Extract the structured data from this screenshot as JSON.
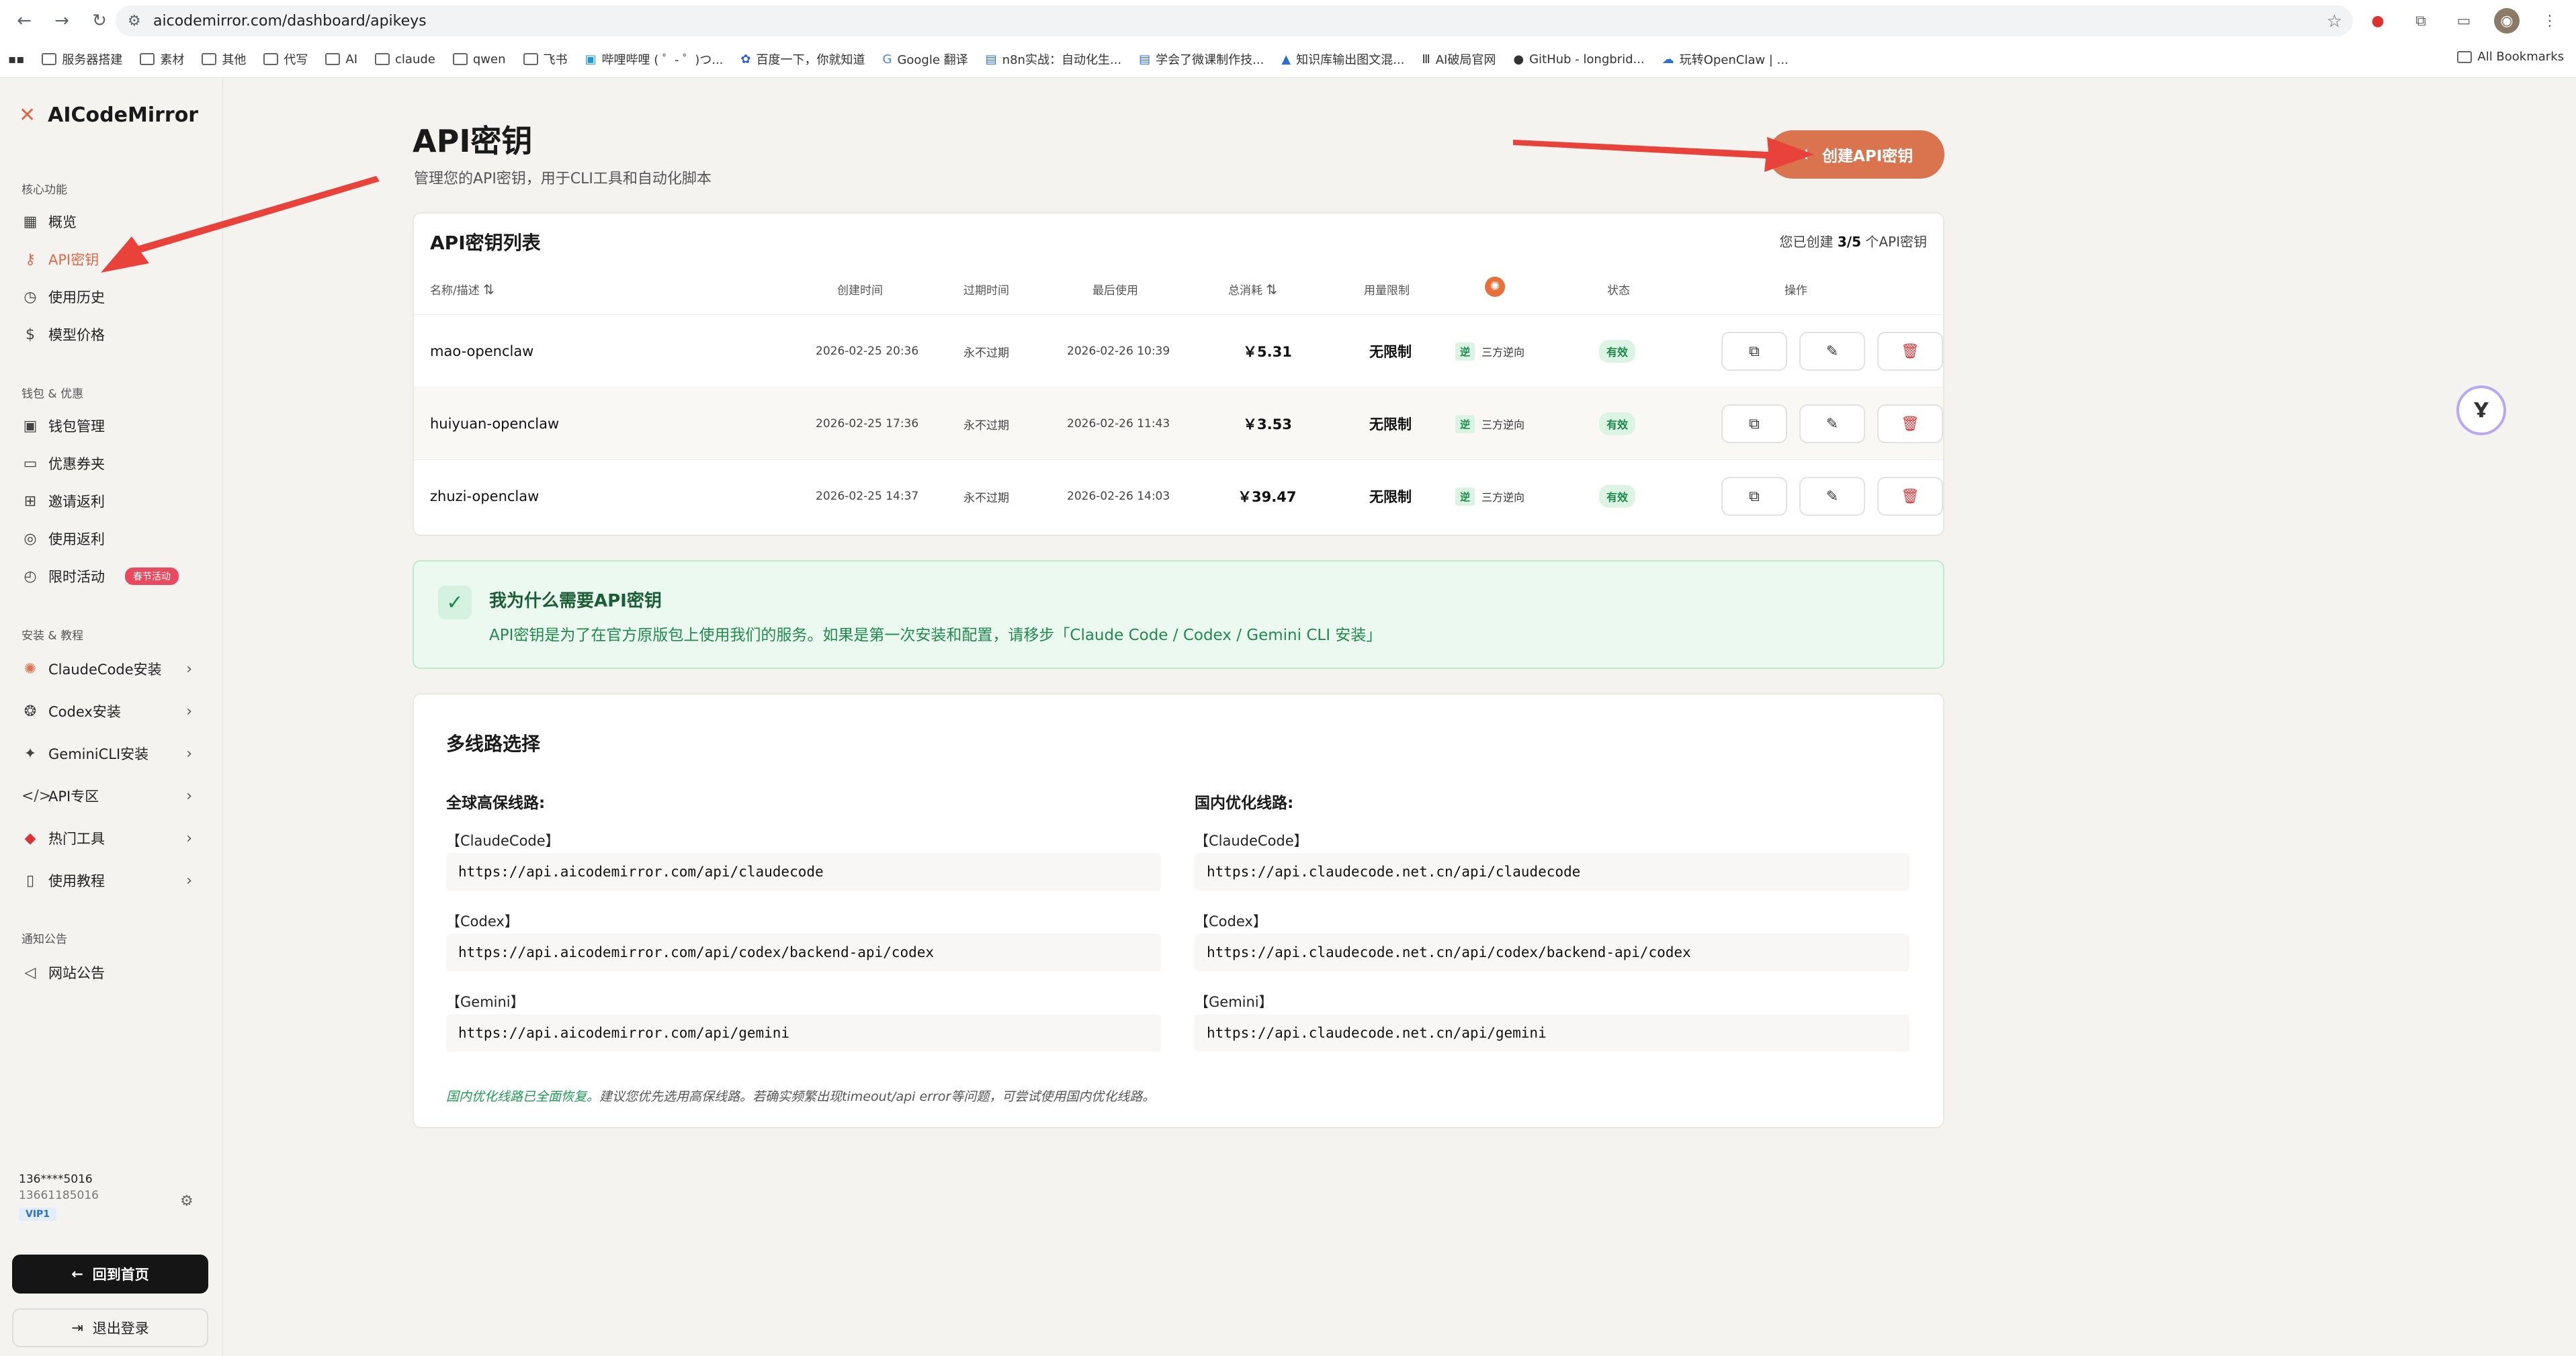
{
  "browser": {
    "url": "aicodemirror.com/dashboard/apikeys",
    "bookmarks": [
      "服务器搭建",
      "素材",
      "其他",
      "代写",
      "AI",
      "claude",
      "qwen",
      "飞书",
      "哔哩哔哩 ( ゜- ゜)つ...",
      "百度一下，你就知道",
      "Google 翻译",
      "n8n实战：自动化生...",
      "学会了微课制作技...",
      "知识库输出图文混...",
      "AI破局官网",
      "GitHub - longbrid...",
      "玩转OpenClaw | ..."
    ],
    "all_bookmarks": "All Bookmarks"
  },
  "sidebar": {
    "brand": "AICodeMirror",
    "sections": {
      "core": "核心功能",
      "wallet": "钱包 & 优惠",
      "install": "安装 & 教程",
      "notice": "通知公告"
    },
    "core_items": [
      "概览",
      "API密钥",
      "使用历史",
      "模型价格"
    ],
    "wallet_items": [
      "钱包管理",
      "优惠券夹",
      "邀请返利",
      "使用返利",
      "限时活动"
    ],
    "hot_badge": "春节活动",
    "install_items": [
      "ClaudeCode安装",
      "Codex安装",
      "GeminiCLI安装",
      "API专区",
      "热门工具",
      "使用教程"
    ],
    "notice_items": [
      "网站公告"
    ],
    "user": {
      "masked": "136****5016",
      "phone": "13661185016",
      "vip": "VIP1"
    },
    "home_button": "回到首页",
    "logout_button": "退出登录"
  },
  "page": {
    "title": "API密钥",
    "subtitle": "管理您的API密钥，用于CLI工具和自动化脚本",
    "create_button": "创建API密钥"
  },
  "table": {
    "title": "API密钥列表",
    "count_prefix": "您已创建",
    "count_value": "3/5",
    "count_suffix": "个API密钥",
    "headers": {
      "name": "名称/描述",
      "created": "创建时间",
      "expires": "过期时间",
      "last_used": "最后使用",
      "total": "总消耗",
      "limit": "用量限制",
      "status": "状态",
      "actions": "操作"
    },
    "rows": [
      {
        "name": "mao-openclaw",
        "created": "2026-02-25 20:36",
        "expires": "永不过期",
        "last_used": "2026-02-26 10:39",
        "total": "￥5.31",
        "limit": "无限制",
        "tag_icon": "逆",
        "tag_text": "三方逆向",
        "status": "有效"
      },
      {
        "name": "huiyuan-openclaw",
        "created": "2026-02-25 17:36",
        "expires": "永不过期",
        "last_used": "2026-02-26 11:43",
        "total": "￥3.53",
        "limit": "无限制",
        "tag_icon": "逆",
        "tag_text": "三方逆向",
        "status": "有效"
      },
      {
        "name": "zhuzi-openclaw",
        "created": "2026-02-25 14:37",
        "expires": "永不过期",
        "last_used": "2026-02-26 14:03",
        "total": "￥39.47",
        "limit": "无限制",
        "tag_icon": "逆",
        "tag_text": "三方逆向",
        "status": "有效"
      }
    ]
  },
  "info": {
    "title": "我为什么需要API密钥",
    "text": "API密钥是为了在官方原版包上使用我们的服务。如果是第一次安装和配置，请移步「Claude Code / Codex / Gemini CLI 安装」"
  },
  "routes": {
    "title": "多线路选择",
    "global_heading": "全球高保线路:",
    "domestic_heading": "国内优化线路:",
    "labels": [
      "【ClaudeCode】",
      "【Codex】",
      "【Gemini】"
    ],
    "global_urls": [
      "https://api.aicodemirror.com/api/claudecode",
      "https://api.aicodemirror.com/api/codex/backend-api/codex",
      "https://api.aicodemirror.com/api/gemini"
    ],
    "domestic_urls": [
      "https://api.claudecode.net.cn/api/claudecode",
      "https://api.claudecode.net.cn/api/codex/backend-api/codex",
      "https://api.claudecode.net.cn/api/gemini"
    ],
    "note_highlight": "国内优化线路已全面恢复。",
    "note_rest": "建议您优先选用高保线路。若确实频繁出现timeout/api error等问题，可尝试使用国内优化线路。"
  },
  "colors": {
    "accent": "#d9744f",
    "success": "#1b8a4b",
    "arrow": "#e8423a"
  }
}
